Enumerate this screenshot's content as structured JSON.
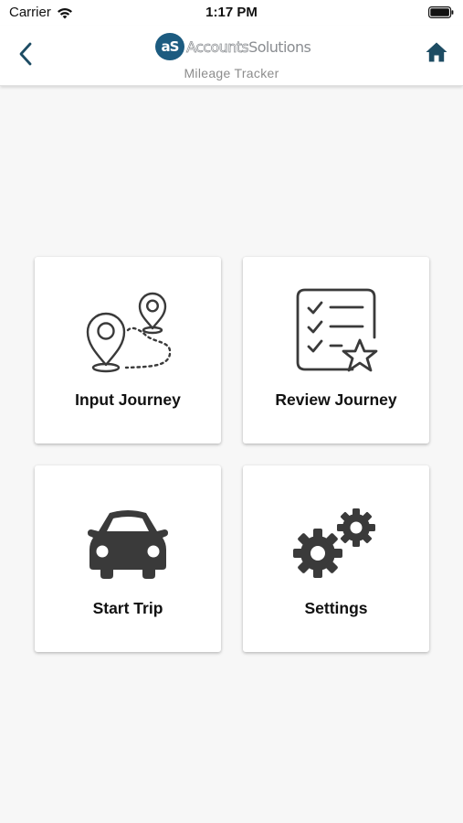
{
  "status_bar": {
    "carrier": "Carrier",
    "time": "1:17 PM"
  },
  "header": {
    "logo_mark": "aS",
    "logo_text_a": "Accounts",
    "logo_text_b": "Solutions",
    "subtitle": "Mileage Tracker",
    "back_icon": "chevron-left-icon",
    "home_icon": "home-icon"
  },
  "colors": {
    "accent": "#1c5b80",
    "header_icon": "#1d4c63",
    "tile_icon": "#3a3a3a"
  },
  "tiles": [
    {
      "label": "Input Journey",
      "icon": "route-map-pin-icon"
    },
    {
      "label": "Review Journey",
      "icon": "checklist-star-icon"
    },
    {
      "label": "Start Trip",
      "icon": "car-icon"
    },
    {
      "label": "Settings",
      "icon": "gears-icon"
    }
  ]
}
